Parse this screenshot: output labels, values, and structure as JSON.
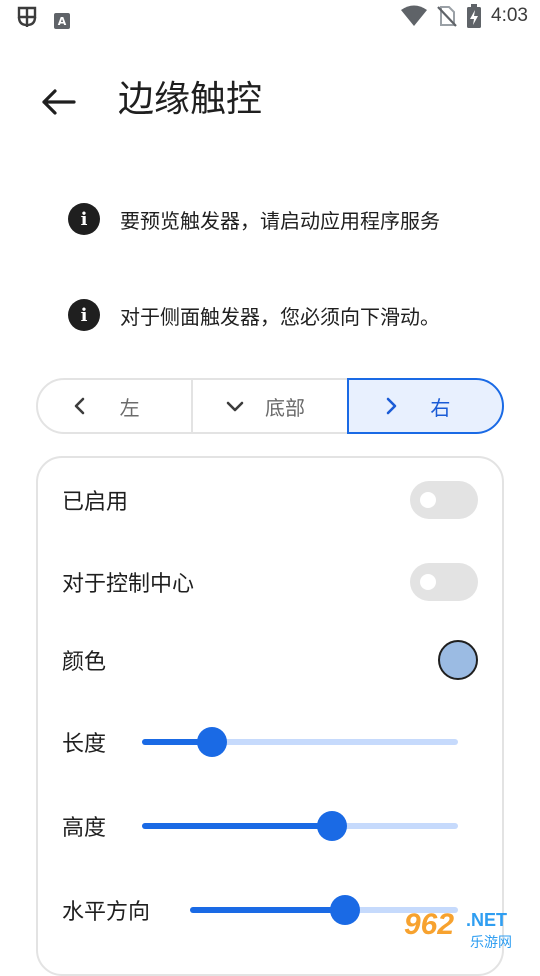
{
  "status_bar": {
    "time": "4:03",
    "icons": [
      "bug-icon",
      "accessibility-a-icon",
      "wifi-icon",
      "no-sim-icon",
      "battery-charging-icon"
    ],
    "a_label": "A"
  },
  "app_bar": {
    "title": "边缘触控",
    "back_icon": "arrow-left-icon"
  },
  "info": [
    {
      "icon": "info-icon",
      "text": "要预览触发器，请启动应用程序服务"
    },
    {
      "icon": "info-icon",
      "text": "对于侧面触发器，您必须向下滑动。"
    }
  ],
  "segments": [
    {
      "label": "左",
      "icon": "chevron-left-icon",
      "selected": false
    },
    {
      "label": "底部",
      "icon": "chevron-down-icon",
      "selected": false
    },
    {
      "label": "右",
      "icon": "chevron-right-icon",
      "selected": true
    }
  ],
  "settings": {
    "enabled_label": "已启用",
    "enabled_value": false,
    "control_center_label": "对于控制中心",
    "control_center_value": false,
    "color_label": "颜色",
    "color_value": "#9bbbe3",
    "length_label": "长度",
    "length_value": 0.22,
    "height_label": "高度",
    "height_value": 0.6,
    "horizontal_label": "水平方向",
    "horizontal_value": 0.58
  },
  "watermark": {
    "number": "962",
    "suffix": ".NET",
    "text": "乐游网"
  },
  "colors": {
    "accent": "#1a6ae5",
    "accent_light": "#c6dafc",
    "selected_bg": "#e8f0fe",
    "toggle_off": "#e3e3e3"
  }
}
